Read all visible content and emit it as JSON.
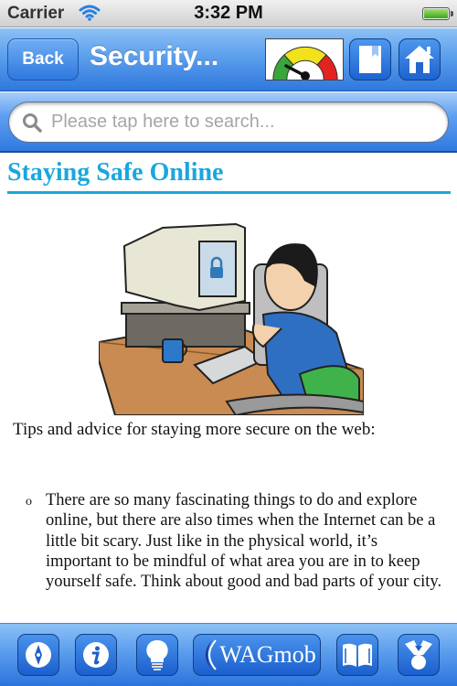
{
  "status_bar": {
    "carrier": "Carrier",
    "time": "3:32 PM",
    "battery_level": 1.0
  },
  "nav_bar": {
    "back_label": "Back",
    "title": "Security...",
    "icons": [
      "gauge-icon",
      "bookmark-icon",
      "home-icon"
    ],
    "gauge_segments": [
      "#3aa63a",
      "#f2e21c",
      "#e2231f"
    ]
  },
  "search": {
    "placeholder": "Please tap here to search...",
    "value": ""
  },
  "content": {
    "title": "Staying Safe Online",
    "title_color": "#1aa7dc",
    "illustration": "person-at-computer-with-lock-screen",
    "intro": "Tips and advice for staying more secure on the web:",
    "bullets": [
      {
        "marker": "o",
        "text": "There are so many fascinating things to do and explore online, but there are also times when the Internet can be a little bit scary. Just like in the physical world, it’s important to be mindful of what area you are in to keep yourself safe.  Think about good and bad parts of your city."
      }
    ]
  },
  "toolbar": {
    "items": [
      {
        "name": "compass",
        "icon": "compass-icon"
      },
      {
        "name": "info",
        "icon": "info-icon"
      },
      {
        "name": "tips",
        "icon": "lightbulb-icon"
      },
      {
        "name": "brand",
        "label": "WAGmob",
        "icon": "wagmob-logo-icon"
      },
      {
        "name": "book",
        "icon": "book-icon"
      },
      {
        "name": "share",
        "icon": "share-icon"
      }
    ]
  },
  "colors": {
    "bar_blue": "#2f78de",
    "accent": "#1aa7dc"
  }
}
